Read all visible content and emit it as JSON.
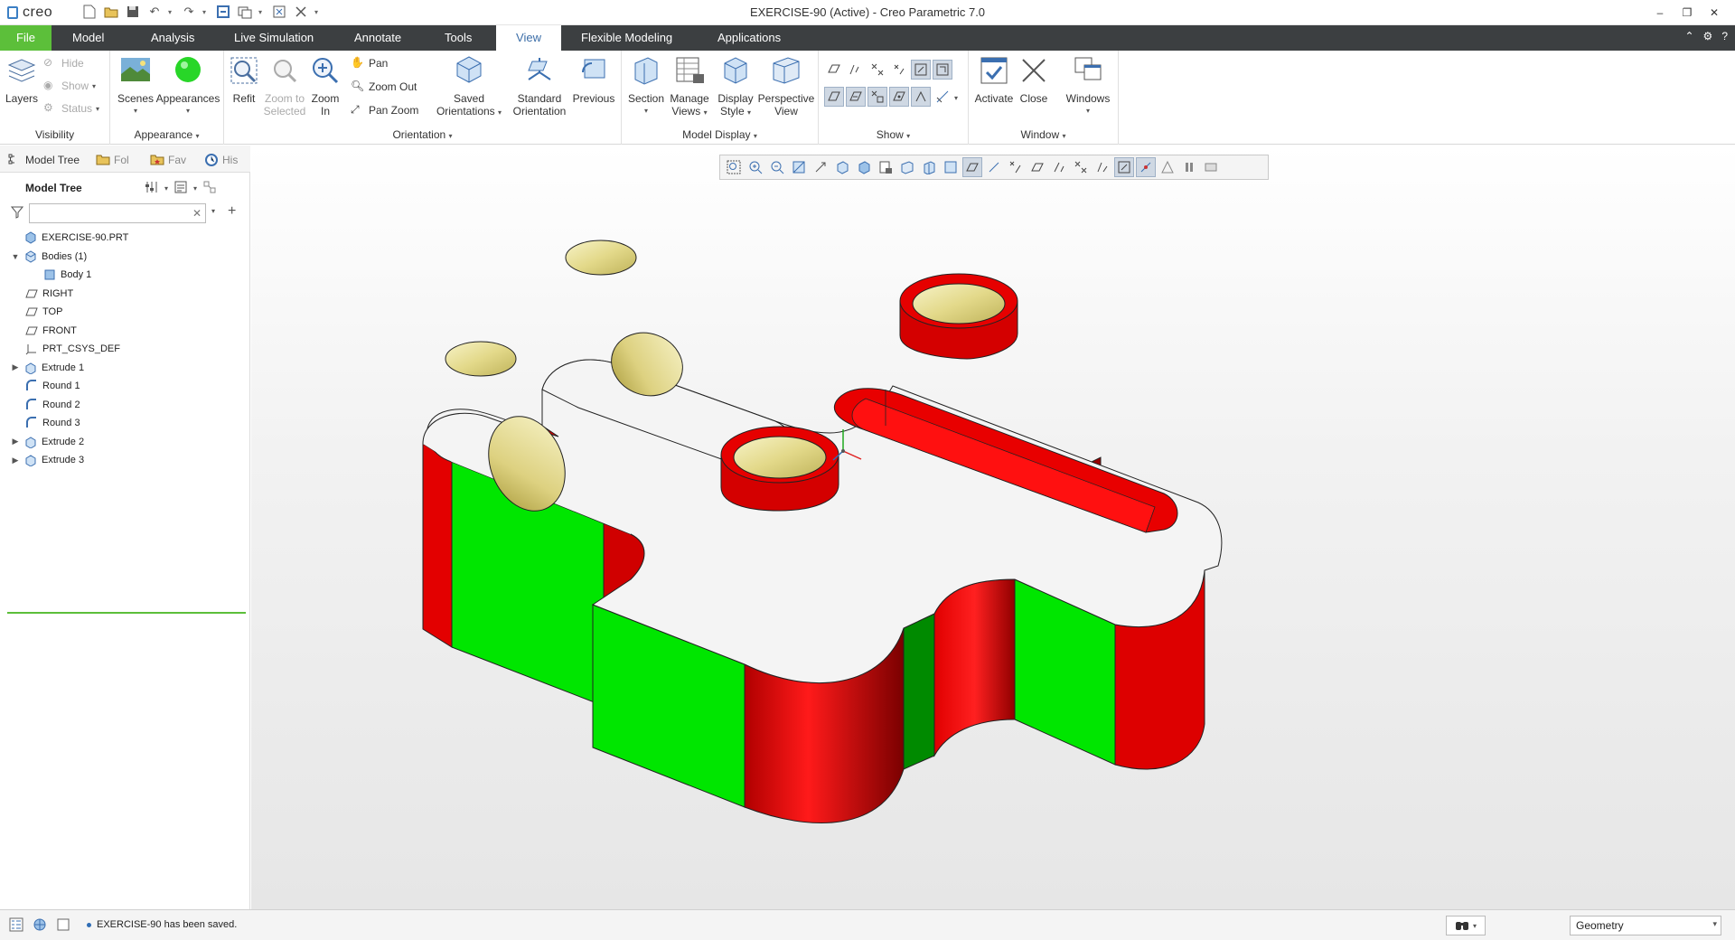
{
  "app": {
    "logo_text": "creo",
    "window_title": "EXERCISE-90 (Active) - Creo Parametric 7.0"
  },
  "tabs": [
    {
      "label": "File"
    },
    {
      "label": "Model"
    },
    {
      "label": "Analysis"
    },
    {
      "label": "Live Simulation"
    },
    {
      "label": "Annotate"
    },
    {
      "label": "Tools"
    },
    {
      "label": "View"
    },
    {
      "label": "Flexible Modeling"
    },
    {
      "label": "Applications"
    }
  ],
  "active_tab": "View",
  "ribbon": {
    "visibility": {
      "group_label": "Visibility",
      "layers": "Layers",
      "hide": "Hide",
      "show": "Show",
      "status": "Status"
    },
    "appearance": {
      "group_label": "Appearance",
      "scenes": "Scenes",
      "appearances": "Appearances"
    },
    "orientation": {
      "group_label": "Orientation",
      "refit": "Refit",
      "zoom_to_selected_1": "Zoom to",
      "zoom_to_selected_2": "Selected",
      "zoom_in_1": "Zoom",
      "zoom_in_2": "In",
      "pan": "Pan",
      "zoom_out": "Zoom Out",
      "pan_zoom": "Pan Zoom",
      "saved_orientations_1": "Saved",
      "saved_orientations_2": "Orientations",
      "standard_orientation_1": "Standard",
      "standard_orientation_2": "Orientation",
      "previous": "Previous"
    },
    "model_display": {
      "group_label": "Model Display",
      "section": "Section",
      "manage_views_1": "Manage",
      "manage_views_2": "Views",
      "display_style_1": "Display",
      "display_style_2": "Style",
      "perspective_view_1": "Perspective",
      "perspective_view_2": "View"
    },
    "show": {
      "group_label": "Show"
    },
    "window": {
      "group_label": "Window",
      "activate": "Activate",
      "close": "Close",
      "windows": "Windows"
    }
  },
  "left_panel": {
    "tabs": [
      {
        "label": "Model Tree"
      },
      {
        "label": "Fol"
      },
      {
        "label": "Fav"
      },
      {
        "label": "His"
      }
    ],
    "header": "Model Tree",
    "search_placeholder": "",
    "tree": [
      {
        "label": "EXERCISE-90.PRT",
        "icon": "part-icon"
      },
      {
        "label": "Bodies (1)",
        "icon": "bodies-icon"
      },
      {
        "label": "Body 1",
        "icon": "body-icon"
      },
      {
        "label": "RIGHT",
        "icon": "datum-plane-icon"
      },
      {
        "label": "TOP",
        "icon": "datum-plane-icon"
      },
      {
        "label": "FRONT",
        "icon": "datum-plane-icon"
      },
      {
        "label": "PRT_CSYS_DEF",
        "icon": "csys-icon"
      },
      {
        "label": "Extrude 1",
        "icon": "extrude-icon"
      },
      {
        "label": "Round 1",
        "icon": "round-icon"
      },
      {
        "label": "Round 2",
        "icon": "round-icon"
      },
      {
        "label": "Round 3",
        "icon": "round-icon"
      },
      {
        "label": "Extrude 2",
        "icon": "extrude-icon"
      },
      {
        "label": "Extrude 3",
        "icon": "extrude-icon"
      }
    ]
  },
  "status": {
    "message": "EXERCISE-90 has been saved.",
    "filter_value": "Geometry"
  },
  "colors": {
    "accent_green": "#5cbf3a",
    "tab_bar": "#3c3f41",
    "face_red": "#e60000",
    "face_green": "#00e600",
    "hole_yellow": "#e8e09a"
  }
}
